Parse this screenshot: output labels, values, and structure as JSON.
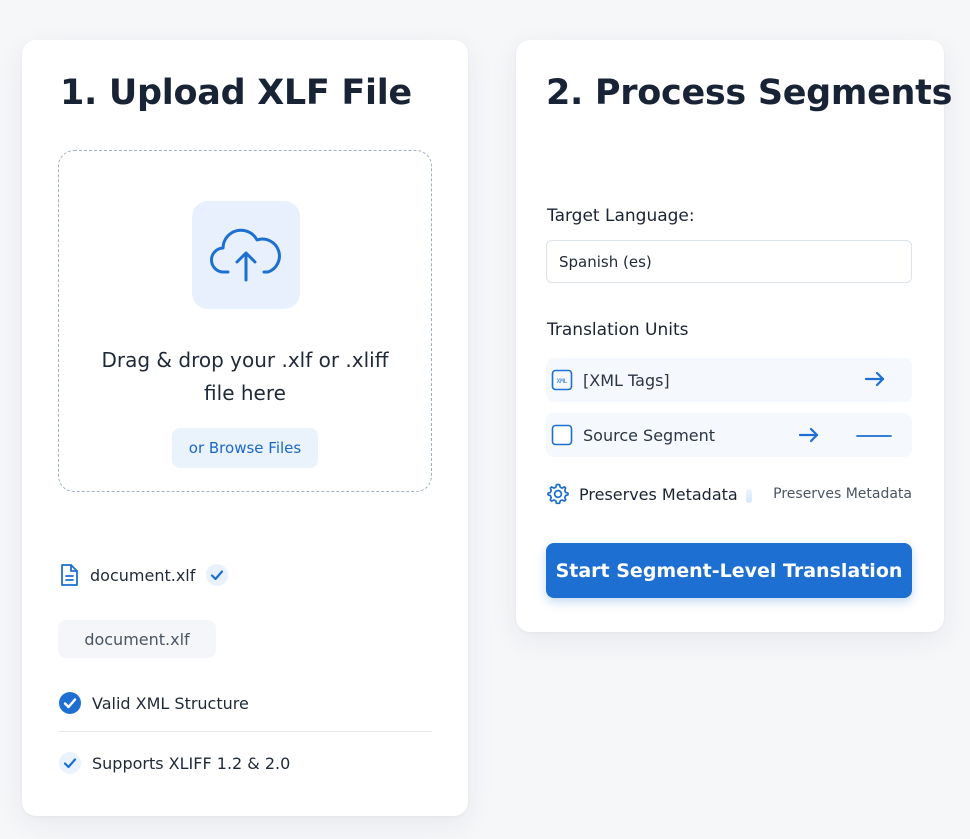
{
  "upload": {
    "title": "1. Upload XLF File",
    "drop_text": "Drag & drop your .xlf or .xliff file here",
    "browse_label": "or Browse Files",
    "file_name": "document.xlf",
    "file_pill": "document.xlf",
    "valid_label": "Valid XML Structure",
    "supports_label": "Supports XLIFF 1.2 & 2.0"
  },
  "process": {
    "title": "2. Process Segments",
    "target_label": "Target Language:",
    "target_value": "Spanish (es)",
    "units_label": "Translation Units",
    "units": [
      {
        "label": "[XML Tags]",
        "icon": "xml-tag-icon"
      },
      {
        "label": "Source Segment",
        "icon": "checkbox-icon"
      }
    ],
    "meta_label": "Preserves Metadata",
    "meta_right": "Preserves Metadata",
    "start_label": "Start Segment-Level Translation"
  },
  "colors": {
    "accent": "#1d6fd1",
    "accent_soft": "#e7f0fc",
    "heading": "#182336",
    "page_bg": "#f6f7f9"
  }
}
